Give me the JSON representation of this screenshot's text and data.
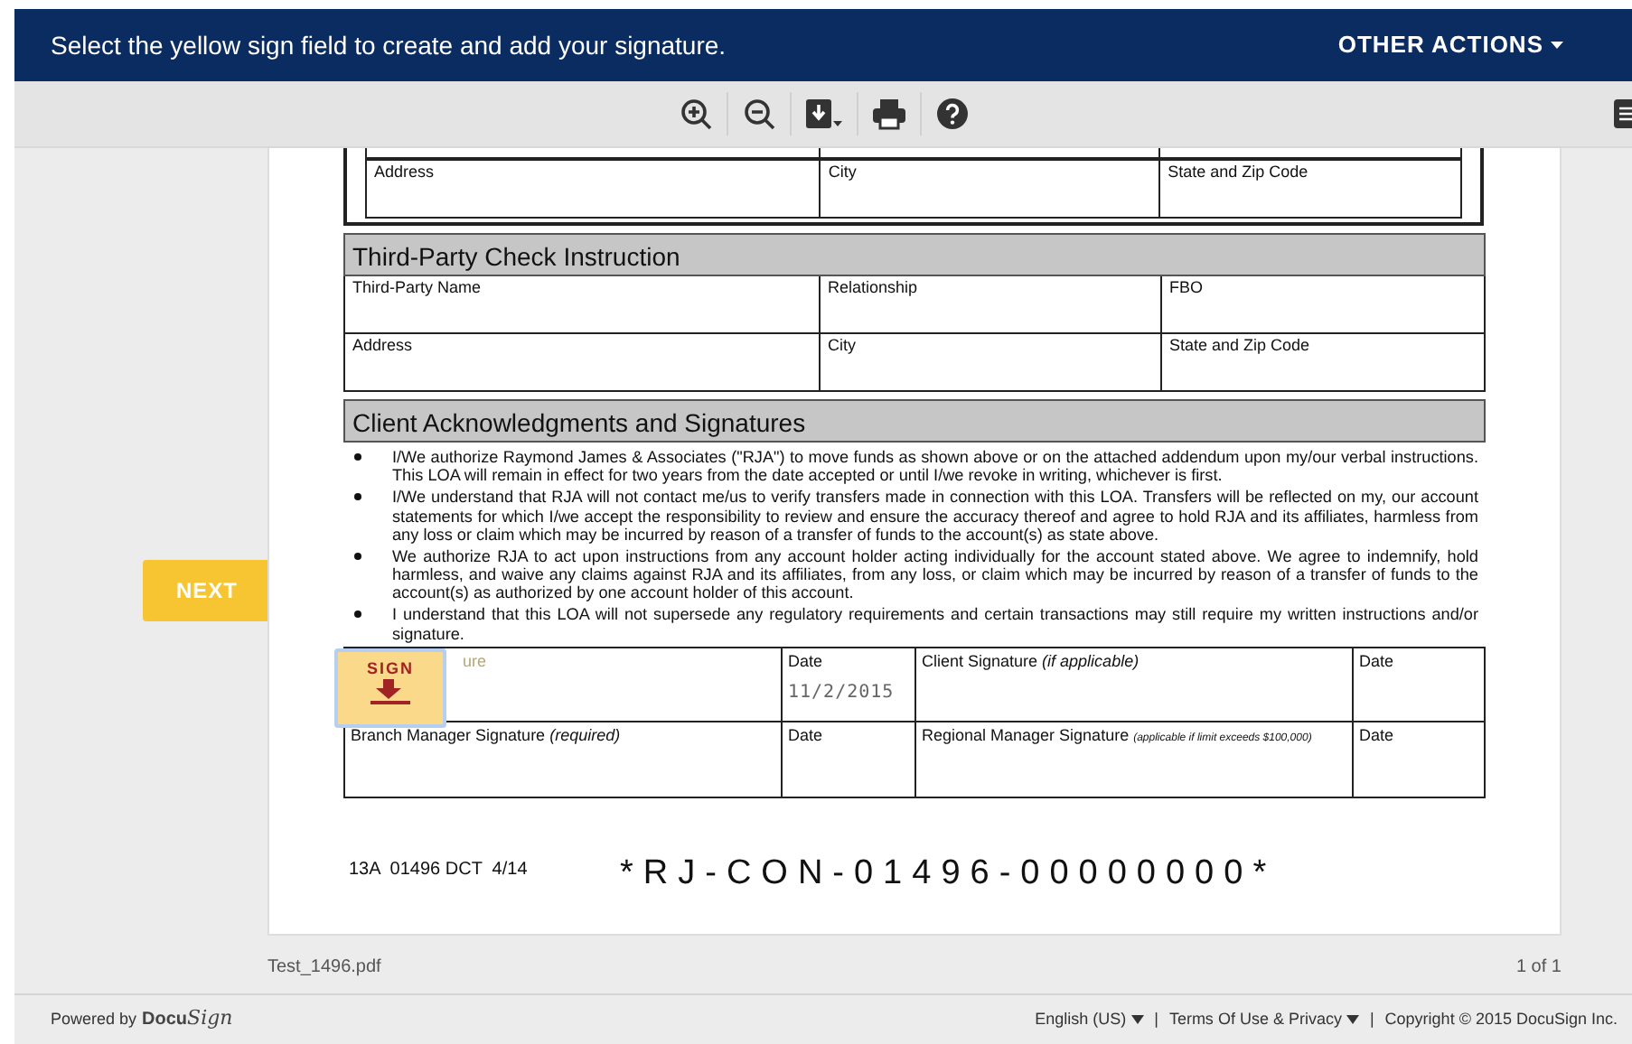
{
  "header": {
    "message": "Select the yellow sign field to create and add your signature.",
    "other_actions": "OTHER ACTIONS"
  },
  "next_button": "NEXT",
  "document": {
    "top_rows": [
      [
        "Address",
        "City",
        "State and Zip Code"
      ]
    ],
    "sections": [
      {
        "title": "Third-Party Check Instruction",
        "rows": [
          [
            "Third-Party Name",
            "Relationship",
            "FBO"
          ],
          [
            "Address",
            "City",
            "State and Zip Code"
          ]
        ]
      },
      {
        "title": "Client Acknowledgments and Signatures"
      }
    ],
    "bullets": [
      "I/We authorize Raymond James & Associates (\"RJA\") to move funds as shown above or on the attached addendum upon my/our verbal instructions. This LOA will remain in effect for two years from the date accepted or until I/we revoke in writing, whichever is first.",
      "I/We understand that RJA will not contact me/us to verify transfers made in connection with this LOA. Transfers will be reflected on my, our account statements for which I/we accept the responsibility to review and ensure the accuracy thereof and agree to hold RJA and its affiliates, harmless from any loss or claim which may be incurred by reason of a transfer of funds  to the account(s) as state above.",
      "We authorize RJA to act upon instructions from any account holder acting individually for the account stated above. We agree to indemnify, hold harmless, and waive any claims against RJA and its affiliates, from any loss, or claim which may be incurred by reason of a transfer of funds to the account(s) as authorized by one account holder of this account.",
      "I understand that this LOA will not supersede any regulatory requirements and certain transactions may still require my written instructions and/or signature."
    ],
    "signature_rows": [
      [
        {
          "label": "ure",
          "sign_tab": "SIGN"
        },
        {
          "label": "Date",
          "value": "11/2/2015"
        },
        {
          "label": "Client Signature *(if applicable)*"
        },
        {
          "label": "Date"
        }
      ],
      [
        {
          "label": "Branch Manager Signature *(required)*"
        },
        {
          "label": "Date"
        },
        {
          "label": "Regional Manager Signature",
          "note": "(applicable if limit exceeds $100,000)"
        },
        {
          "label": "Date"
        }
      ]
    ],
    "form_code": "13A  01496 DCT  4/14",
    "barcode_text": "*RJ-CON-01496-00000000*"
  },
  "file_name": "Test_1496.pdf",
  "page_count": "1 of 1",
  "footer": {
    "powered_by": "Powered by",
    "brand_bold": "Docu",
    "brand_script": "Sign",
    "language": "English (US)",
    "separator": "|",
    "terms": "Terms Of Use & Privacy",
    "copyright": "Copyright © 2015 DocuSign Inc."
  }
}
